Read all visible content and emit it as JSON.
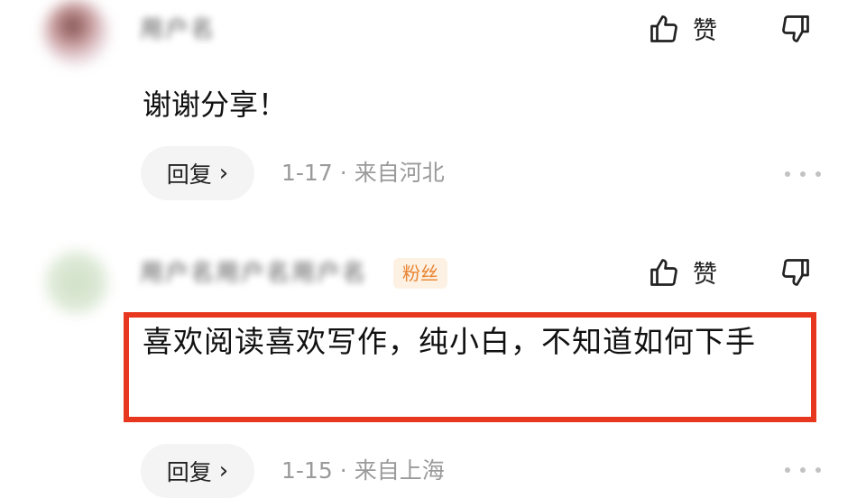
{
  "comments": [
    {
      "username": "用户名",
      "text": "谢谢分享！",
      "like_label": "赞",
      "reply_label": "回复",
      "reply_chevron": "›",
      "date": "1-17",
      "location": "来自河北",
      "icons": {
        "like": "thumbs-up-icon",
        "dislike": "thumbs-down-icon",
        "more": "more-dots-icon"
      }
    },
    {
      "username": "用户名用户名用户名",
      "badge": "粉丝",
      "text": "喜欢阅读喜欢写作，纯小白，不知道如何下手",
      "like_label": "赞",
      "reply_label": "回复",
      "reply_chevron": "›",
      "date": "1-15",
      "location": "来自上海",
      "icons": {
        "like": "thumbs-up-icon",
        "dislike": "thumbs-down-icon",
        "more": "more-dots-icon"
      }
    }
  ],
  "separator": "·",
  "colors": {
    "highlight": "#e8371f",
    "badge_text": "#e8832f",
    "meta": "#9a9a9a"
  }
}
